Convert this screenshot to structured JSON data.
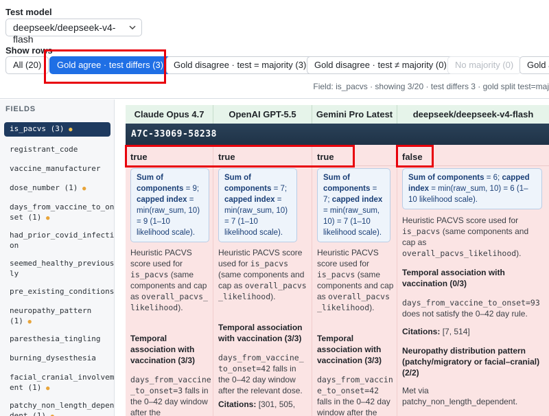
{
  "test_model": {
    "label": "Test model",
    "selected": "deepseek/deepseek-v4-flash"
  },
  "show_rows": {
    "label": "Show rows",
    "filters": [
      {
        "label": "All (20)"
      },
      {
        "label": "Gold agree · test differs (3)",
        "active": true
      },
      {
        "label": "Gold disagree · test = majority (3)"
      },
      {
        "label": "Gold disagree · test ≠ majority (0)"
      },
      {
        "label": "No majority (0)",
        "disabled": true
      },
      {
        "label": "Gold a"
      }
    ],
    "field_info": "Field: is_pacvs · showing 3/20 · test differs 3 · gold split test=maj"
  },
  "sidebar": {
    "title": "FIELDS",
    "items": [
      {
        "label": "is_pacvs (3)",
        "dot": "●",
        "active": true
      },
      {
        "label": "registrant_code"
      },
      {
        "label": "vaccine_manufacturer"
      },
      {
        "label": "dose_number (1)",
        "dot": "●"
      },
      {
        "label": "days_from_vaccine_to_on set (1)",
        "dot": "●"
      },
      {
        "label": "had_prior_covid_infecti on"
      },
      {
        "label": "seemed_healthy_previous ly"
      },
      {
        "label": "pre_existing_conditions"
      },
      {
        "label": "neuropathy_pattern (1)",
        "dot": "●"
      },
      {
        "label": "paresthesia_tingling"
      },
      {
        "label": "burning_dysesthesia"
      },
      {
        "label": "facial_cranial_involvem ent (1)",
        "dot": "●"
      },
      {
        "label": "patchy_non_length_depen dent (1)",
        "dot": "●"
      }
    ]
  },
  "columns": {
    "headers": [
      "Claude Opus 4.7",
      "OpenAI GPT-5.5",
      "Gemini Pro Latest",
      "deepseek/deepseek-v4-flash"
    ]
  },
  "record": {
    "id": "A7C-33069-58238",
    "cells": [
      {
        "value": "true",
        "sum_bold1": "Sum of components",
        "sum_text1": " = 9; ",
        "sum_bold2": "capped index",
        "sum_text2": " = min(raw_sum, 10) = 9 (1–10 likelihood scale).",
        "desc_a": "Heuristic PACVS score used for ",
        "desc_code1": "is_pacvs",
        "desc_b": " (same components and cap as ",
        "desc_code2": "overall_pacvs_likelihood",
        "desc_c": ").",
        "section1": "Temporal association with vaccination (3/3)",
        "detail_code": "days_from_vaccine_to_onset=3",
        "detail_text": " falls in the 0–42 day window after the"
      },
      {
        "value": "true",
        "sum_bold1": "Sum of components",
        "sum_text1": " = 7; ",
        "sum_bold2": "capped index",
        "sum_text2": " = min(raw_sum, 10) = 7 (1–10 likelihood scale).",
        "desc_a": "Heuristic PACVS score used for ",
        "desc_code1": "is_pacvs",
        "desc_b": " (same components and cap as ",
        "desc_code2": "overall_pacvs_likelihood",
        "desc_c": ").",
        "section1": "Temporal association with vaccination (3/3)",
        "detail_code": "days_from_vaccine_to_onset=42",
        "detail_text": " falls in the 0–42 day window after the relevant dose.",
        "citations_label": "Citations:",
        "citations": "[301, 505,"
      },
      {
        "value": "true",
        "sum_bold1": "Sum of components",
        "sum_text1": " = 7; ",
        "sum_bold2": "capped index",
        "sum_text2": " = min(raw_sum, 10) = 7 (1–10 likelihood scale).",
        "desc_a": "Heuristic PACVS score used for ",
        "desc_code1": "is_pacvs",
        "desc_b": " (same components and cap as ",
        "desc_code2": "overall_pacvs_likelihood",
        "desc_c": ").",
        "section1": "Temporal association with vaccination (3/3)",
        "detail_code": "days_from_vaccine_to_onset=42",
        "detail_text": " falls in the 0–42 day window after the"
      },
      {
        "value": "false",
        "sum_bold1": "Sum of components",
        "sum_text1": " = 6; ",
        "sum_bold2": "capped index",
        "sum_text2": " = min(raw_sum, 10) = 6 (1–10 likelihood scale).",
        "desc_a": "Heuristic PACVS score used for ",
        "desc_code1": "is_pacvs",
        "desc_b": " (same components and cap as ",
        "desc_code2": "overall_pacvs_likelihood",
        "desc_c": ").",
        "section1": "Temporal association with vaccination (0/3)",
        "detail_code": "days_from_vaccine_to_onset=93",
        "detail_text": " does not satisfy the 0–42 day rule.",
        "citations_label": "Citations:",
        "citations": "[7, 514]",
        "section2": "Neuropathy distribution pattern (patchy/migratory or facial–cranial) (2/2)",
        "met_label": "Met via",
        "met_value": "patchy_non_length_dependent."
      }
    ]
  },
  "colors": {
    "accent": "#1f6fe5",
    "highlight": "#e8000b",
    "header_green": "#e6f4ea",
    "cell_red": "#fbe4e4",
    "record_bar": "#1f3347",
    "count_dot": "#e8a43a"
  }
}
